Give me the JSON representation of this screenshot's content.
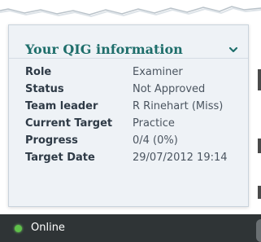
{
  "panel": {
    "title": "Your QIG information",
    "collapse_icon": "chevron-down-icon",
    "rows": [
      {
        "label": "Role",
        "value": "Examiner"
      },
      {
        "label": "Status",
        "value": "Not Approved"
      },
      {
        "label": "Team leader",
        "value": "R Rinehart (Miss)"
      },
      {
        "label": "Current Target",
        "value": "Practice"
      },
      {
        "label": "Progress",
        "value": "0/4 (0%)"
      },
      {
        "label": "Target Date",
        "value": "29/07/2012 19:14"
      }
    ]
  },
  "status_bar": {
    "label": "Online",
    "indicator_color": "#5fc14a"
  },
  "colors": {
    "title": "#1e6e6b",
    "panel_bg": "#eef2f6",
    "status_bar_bg": "#2f3436"
  }
}
